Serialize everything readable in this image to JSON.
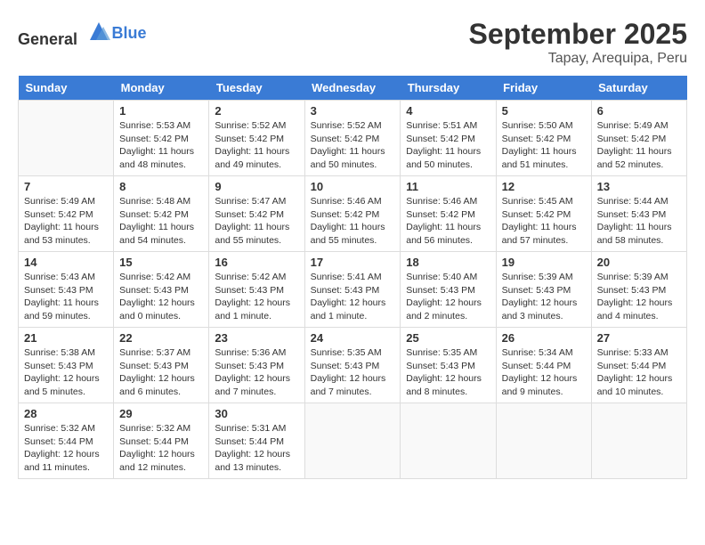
{
  "header": {
    "logo_general": "General",
    "logo_blue": "Blue",
    "month": "September 2025",
    "location": "Tapay, Arequipa, Peru"
  },
  "days_of_week": [
    "Sunday",
    "Monday",
    "Tuesday",
    "Wednesday",
    "Thursday",
    "Friday",
    "Saturday"
  ],
  "weeks": [
    [
      {
        "day": "",
        "info": ""
      },
      {
        "day": "1",
        "info": "Sunrise: 5:53 AM\nSunset: 5:42 PM\nDaylight: 11 hours\nand 48 minutes."
      },
      {
        "day": "2",
        "info": "Sunrise: 5:52 AM\nSunset: 5:42 PM\nDaylight: 11 hours\nand 49 minutes."
      },
      {
        "day": "3",
        "info": "Sunrise: 5:52 AM\nSunset: 5:42 PM\nDaylight: 11 hours\nand 50 minutes."
      },
      {
        "day": "4",
        "info": "Sunrise: 5:51 AM\nSunset: 5:42 PM\nDaylight: 11 hours\nand 50 minutes."
      },
      {
        "day": "5",
        "info": "Sunrise: 5:50 AM\nSunset: 5:42 PM\nDaylight: 11 hours\nand 51 minutes."
      },
      {
        "day": "6",
        "info": "Sunrise: 5:49 AM\nSunset: 5:42 PM\nDaylight: 11 hours\nand 52 minutes."
      }
    ],
    [
      {
        "day": "7",
        "info": "Sunrise: 5:49 AM\nSunset: 5:42 PM\nDaylight: 11 hours\nand 53 minutes."
      },
      {
        "day": "8",
        "info": "Sunrise: 5:48 AM\nSunset: 5:42 PM\nDaylight: 11 hours\nand 54 minutes."
      },
      {
        "day": "9",
        "info": "Sunrise: 5:47 AM\nSunset: 5:42 PM\nDaylight: 11 hours\nand 55 minutes."
      },
      {
        "day": "10",
        "info": "Sunrise: 5:46 AM\nSunset: 5:42 PM\nDaylight: 11 hours\nand 55 minutes."
      },
      {
        "day": "11",
        "info": "Sunrise: 5:46 AM\nSunset: 5:42 PM\nDaylight: 11 hours\nand 56 minutes."
      },
      {
        "day": "12",
        "info": "Sunrise: 5:45 AM\nSunset: 5:42 PM\nDaylight: 11 hours\nand 57 minutes."
      },
      {
        "day": "13",
        "info": "Sunrise: 5:44 AM\nSunset: 5:43 PM\nDaylight: 11 hours\nand 58 minutes."
      }
    ],
    [
      {
        "day": "14",
        "info": "Sunrise: 5:43 AM\nSunset: 5:43 PM\nDaylight: 11 hours\nand 59 minutes."
      },
      {
        "day": "15",
        "info": "Sunrise: 5:42 AM\nSunset: 5:43 PM\nDaylight: 12 hours\nand 0 minutes."
      },
      {
        "day": "16",
        "info": "Sunrise: 5:42 AM\nSunset: 5:43 PM\nDaylight: 12 hours\nand 1 minute."
      },
      {
        "day": "17",
        "info": "Sunrise: 5:41 AM\nSunset: 5:43 PM\nDaylight: 12 hours\nand 1 minute."
      },
      {
        "day": "18",
        "info": "Sunrise: 5:40 AM\nSunset: 5:43 PM\nDaylight: 12 hours\nand 2 minutes."
      },
      {
        "day": "19",
        "info": "Sunrise: 5:39 AM\nSunset: 5:43 PM\nDaylight: 12 hours\nand 3 minutes."
      },
      {
        "day": "20",
        "info": "Sunrise: 5:39 AM\nSunset: 5:43 PM\nDaylight: 12 hours\nand 4 minutes."
      }
    ],
    [
      {
        "day": "21",
        "info": "Sunrise: 5:38 AM\nSunset: 5:43 PM\nDaylight: 12 hours\nand 5 minutes."
      },
      {
        "day": "22",
        "info": "Sunrise: 5:37 AM\nSunset: 5:43 PM\nDaylight: 12 hours\nand 6 minutes."
      },
      {
        "day": "23",
        "info": "Sunrise: 5:36 AM\nSunset: 5:43 PM\nDaylight: 12 hours\nand 7 minutes."
      },
      {
        "day": "24",
        "info": "Sunrise: 5:35 AM\nSunset: 5:43 PM\nDaylight: 12 hours\nand 7 minutes."
      },
      {
        "day": "25",
        "info": "Sunrise: 5:35 AM\nSunset: 5:43 PM\nDaylight: 12 hours\nand 8 minutes."
      },
      {
        "day": "26",
        "info": "Sunrise: 5:34 AM\nSunset: 5:44 PM\nDaylight: 12 hours\nand 9 minutes."
      },
      {
        "day": "27",
        "info": "Sunrise: 5:33 AM\nSunset: 5:44 PM\nDaylight: 12 hours\nand 10 minutes."
      }
    ],
    [
      {
        "day": "28",
        "info": "Sunrise: 5:32 AM\nSunset: 5:44 PM\nDaylight: 12 hours\nand 11 minutes."
      },
      {
        "day": "29",
        "info": "Sunrise: 5:32 AM\nSunset: 5:44 PM\nDaylight: 12 hours\nand 12 minutes."
      },
      {
        "day": "30",
        "info": "Sunrise: 5:31 AM\nSunset: 5:44 PM\nDaylight: 12 hours\nand 13 minutes."
      },
      {
        "day": "",
        "info": ""
      },
      {
        "day": "",
        "info": ""
      },
      {
        "day": "",
        "info": ""
      },
      {
        "day": "",
        "info": ""
      }
    ]
  ]
}
